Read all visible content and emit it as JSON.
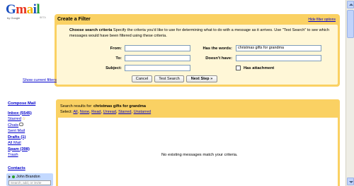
{
  "logo": {
    "word": [
      "G",
      "m",
      "a",
      "i",
      "l"
    ],
    "word_colors": [
      "#1b4fbf",
      "#e8331c",
      "#f5b400",
      "#1b4fbf",
      "#1e9b3a"
    ],
    "by_line": "by Google",
    "beta": "BETA"
  },
  "filter": {
    "title": "Create a Filter",
    "hide_options": "Hide filter options",
    "criteria_heading": "Choose search criteria",
    "criteria_body": " Specify the criteria you'd like to use for determining what to do with a message as it arrives. Use \"Test Search\" to see which messages would have been filtered using these criteria.",
    "fields": {
      "from_label": "From:",
      "from_value": "",
      "to_label": "To:",
      "to_value": "",
      "subject_label": "Subject:",
      "subject_value": "",
      "has_words_label": "Has the words:",
      "has_words_value": "christmas gifts for grandma",
      "doesnt_have_label": "Doesn't have:",
      "doesnt_have_value": "",
      "has_attachment_label": "Has attachment"
    },
    "show_filters": "Show current filters",
    "buttons": {
      "cancel": "Cancel",
      "test": "Test Search",
      "next": "Next Step »"
    }
  },
  "nav": {
    "compose": "Compose Mail",
    "items": [
      "Inbox (5545)",
      "Starred",
      "Chats",
      "Sent Mail",
      "Drafts (1)",
      "All Mail",
      "Spam (398)",
      "Trash"
    ],
    "bold_items": [
      "Inbox (5545)",
      "Drafts (1)",
      "Spam (398)"
    ]
  },
  "contacts": {
    "header": "Contacts",
    "name": "John Brandon",
    "search_placeholder": "Search, add, or invite"
  },
  "results": {
    "prefix": "Search results for: ",
    "query": "christmas gifts for grandma",
    "select_label": "Select:",
    "select_options": [
      "All",
      "None",
      "Read",
      "Unread",
      "Starred",
      "Unstarred"
    ],
    "empty": "No existing messages match your criteria."
  },
  "colors": {
    "panel": "#fad163",
    "panel_inner": "#fff7d7",
    "link": "#0000cc",
    "contact_box": "#c3d9ff",
    "online": "#2a9d2a"
  }
}
